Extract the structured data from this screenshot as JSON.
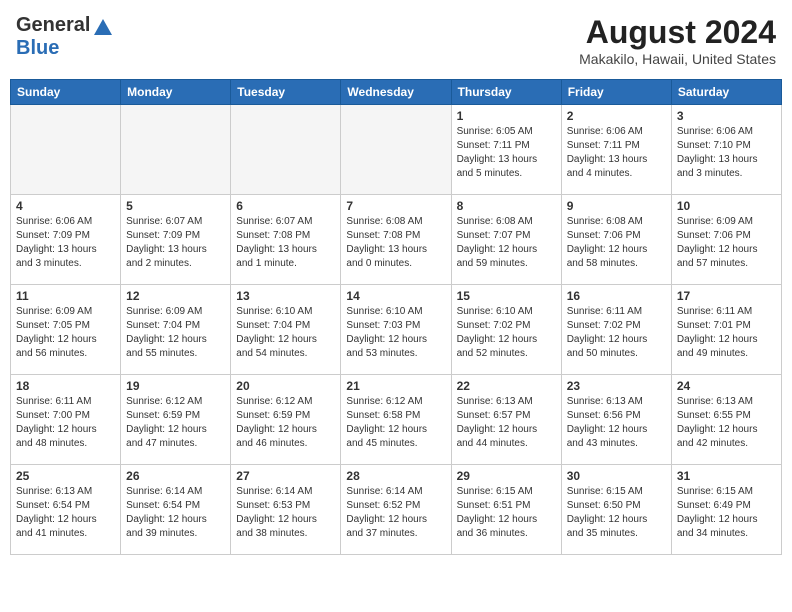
{
  "header": {
    "logo_general": "General",
    "logo_blue": "Blue",
    "month_year": "August 2024",
    "location": "Makakilo, Hawaii, United States"
  },
  "weekdays": [
    "Sunday",
    "Monday",
    "Tuesday",
    "Wednesday",
    "Thursday",
    "Friday",
    "Saturday"
  ],
  "weeks": [
    [
      {
        "day": "",
        "empty": true
      },
      {
        "day": "",
        "empty": true
      },
      {
        "day": "",
        "empty": true
      },
      {
        "day": "",
        "empty": true
      },
      {
        "day": "1",
        "sunrise": "6:05 AM",
        "sunset": "7:11 PM",
        "daylight": "13 hours and 5 minutes."
      },
      {
        "day": "2",
        "sunrise": "6:06 AM",
        "sunset": "7:11 PM",
        "daylight": "13 hours and 4 minutes."
      },
      {
        "day": "3",
        "sunrise": "6:06 AM",
        "sunset": "7:10 PM",
        "daylight": "13 hours and 3 minutes."
      }
    ],
    [
      {
        "day": "4",
        "sunrise": "6:06 AM",
        "sunset": "7:09 PM",
        "daylight": "13 hours and 3 minutes."
      },
      {
        "day": "5",
        "sunrise": "6:07 AM",
        "sunset": "7:09 PM",
        "daylight": "13 hours and 2 minutes."
      },
      {
        "day": "6",
        "sunrise": "6:07 AM",
        "sunset": "7:08 PM",
        "daylight": "13 hours and 1 minute."
      },
      {
        "day": "7",
        "sunrise": "6:08 AM",
        "sunset": "7:08 PM",
        "daylight": "13 hours and 0 minutes."
      },
      {
        "day": "8",
        "sunrise": "6:08 AM",
        "sunset": "7:07 PM",
        "daylight": "12 hours and 59 minutes."
      },
      {
        "day": "9",
        "sunrise": "6:08 AM",
        "sunset": "7:06 PM",
        "daylight": "12 hours and 58 minutes."
      },
      {
        "day": "10",
        "sunrise": "6:09 AM",
        "sunset": "7:06 PM",
        "daylight": "12 hours and 57 minutes."
      }
    ],
    [
      {
        "day": "11",
        "sunrise": "6:09 AM",
        "sunset": "7:05 PM",
        "daylight": "12 hours and 56 minutes."
      },
      {
        "day": "12",
        "sunrise": "6:09 AM",
        "sunset": "7:04 PM",
        "daylight": "12 hours and 55 minutes."
      },
      {
        "day": "13",
        "sunrise": "6:10 AM",
        "sunset": "7:04 PM",
        "daylight": "12 hours and 54 minutes."
      },
      {
        "day": "14",
        "sunrise": "6:10 AM",
        "sunset": "7:03 PM",
        "daylight": "12 hours and 53 minutes."
      },
      {
        "day": "15",
        "sunrise": "6:10 AM",
        "sunset": "7:02 PM",
        "daylight": "12 hours and 52 minutes."
      },
      {
        "day": "16",
        "sunrise": "6:11 AM",
        "sunset": "7:02 PM",
        "daylight": "12 hours and 50 minutes."
      },
      {
        "day": "17",
        "sunrise": "6:11 AM",
        "sunset": "7:01 PM",
        "daylight": "12 hours and 49 minutes."
      }
    ],
    [
      {
        "day": "18",
        "sunrise": "6:11 AM",
        "sunset": "7:00 PM",
        "daylight": "12 hours and 48 minutes."
      },
      {
        "day": "19",
        "sunrise": "6:12 AM",
        "sunset": "6:59 PM",
        "daylight": "12 hours and 47 minutes."
      },
      {
        "day": "20",
        "sunrise": "6:12 AM",
        "sunset": "6:59 PM",
        "daylight": "12 hours and 46 minutes."
      },
      {
        "day": "21",
        "sunrise": "6:12 AM",
        "sunset": "6:58 PM",
        "daylight": "12 hours and 45 minutes."
      },
      {
        "day": "22",
        "sunrise": "6:13 AM",
        "sunset": "6:57 PM",
        "daylight": "12 hours and 44 minutes."
      },
      {
        "day": "23",
        "sunrise": "6:13 AM",
        "sunset": "6:56 PM",
        "daylight": "12 hours and 43 minutes."
      },
      {
        "day": "24",
        "sunrise": "6:13 AM",
        "sunset": "6:55 PM",
        "daylight": "12 hours and 42 minutes."
      }
    ],
    [
      {
        "day": "25",
        "sunrise": "6:13 AM",
        "sunset": "6:54 PM",
        "daylight": "12 hours and 41 minutes."
      },
      {
        "day": "26",
        "sunrise": "6:14 AM",
        "sunset": "6:54 PM",
        "daylight": "12 hours and 39 minutes."
      },
      {
        "day": "27",
        "sunrise": "6:14 AM",
        "sunset": "6:53 PM",
        "daylight": "12 hours and 38 minutes."
      },
      {
        "day": "28",
        "sunrise": "6:14 AM",
        "sunset": "6:52 PM",
        "daylight": "12 hours and 37 minutes."
      },
      {
        "day": "29",
        "sunrise": "6:15 AM",
        "sunset": "6:51 PM",
        "daylight": "12 hours and 36 minutes."
      },
      {
        "day": "30",
        "sunrise": "6:15 AM",
        "sunset": "6:50 PM",
        "daylight": "12 hours and 35 minutes."
      },
      {
        "day": "31",
        "sunrise": "6:15 AM",
        "sunset": "6:49 PM",
        "daylight": "12 hours and 34 minutes."
      }
    ]
  ]
}
